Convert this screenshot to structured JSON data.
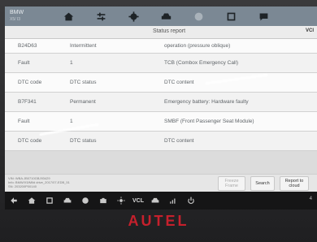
{
  "app": {
    "brand": "BMW",
    "brand_sub": "X5/ I3"
  },
  "toolbar": {
    "icons": [
      "home-icon",
      "tools-icon",
      "settings-icon",
      "vehicle-icon",
      "record-icon",
      "folder-icon",
      "message-icon"
    ]
  },
  "status": {
    "title": "Status report",
    "right_label": "VCI"
  },
  "rows": [
    {
      "c1": "B24D63",
      "c2": "Intermittent",
      "c3": "operation (pressure oblique)"
    },
    {
      "c1": "Fault",
      "c2": "1",
      "c3": "TCB (Combox Emergency Call)"
    },
    {
      "c1": "DTC code",
      "c2": "DTC status",
      "c3": "DTC content"
    },
    {
      "c1": "B7F341",
      "c2": "Permanent",
      "c3": "Emergency battery: Hardware faulty"
    },
    {
      "c1": "Fault",
      "c2": "1",
      "c3": "SMBF (Front Passenger Seat Module)"
    },
    {
      "c1": "DTC code",
      "c2": "DTC status",
      "c3": "DTC content"
    }
  ],
  "footer": {
    "vin_lines": [
      "VIN: WBA.JB0710GBJ93429",
      "Info: BMW/X5/Mild drive_2017/07-EDB_51",
      "SN: 203200P00140"
    ],
    "freeze_label": "Freeze Frame",
    "search_label": "Search",
    "report_label": "Report to cloud"
  },
  "navbar": {
    "vcl_label": "VCL",
    "right_label": "4"
  },
  "device": {
    "logo": "AUTEL"
  }
}
